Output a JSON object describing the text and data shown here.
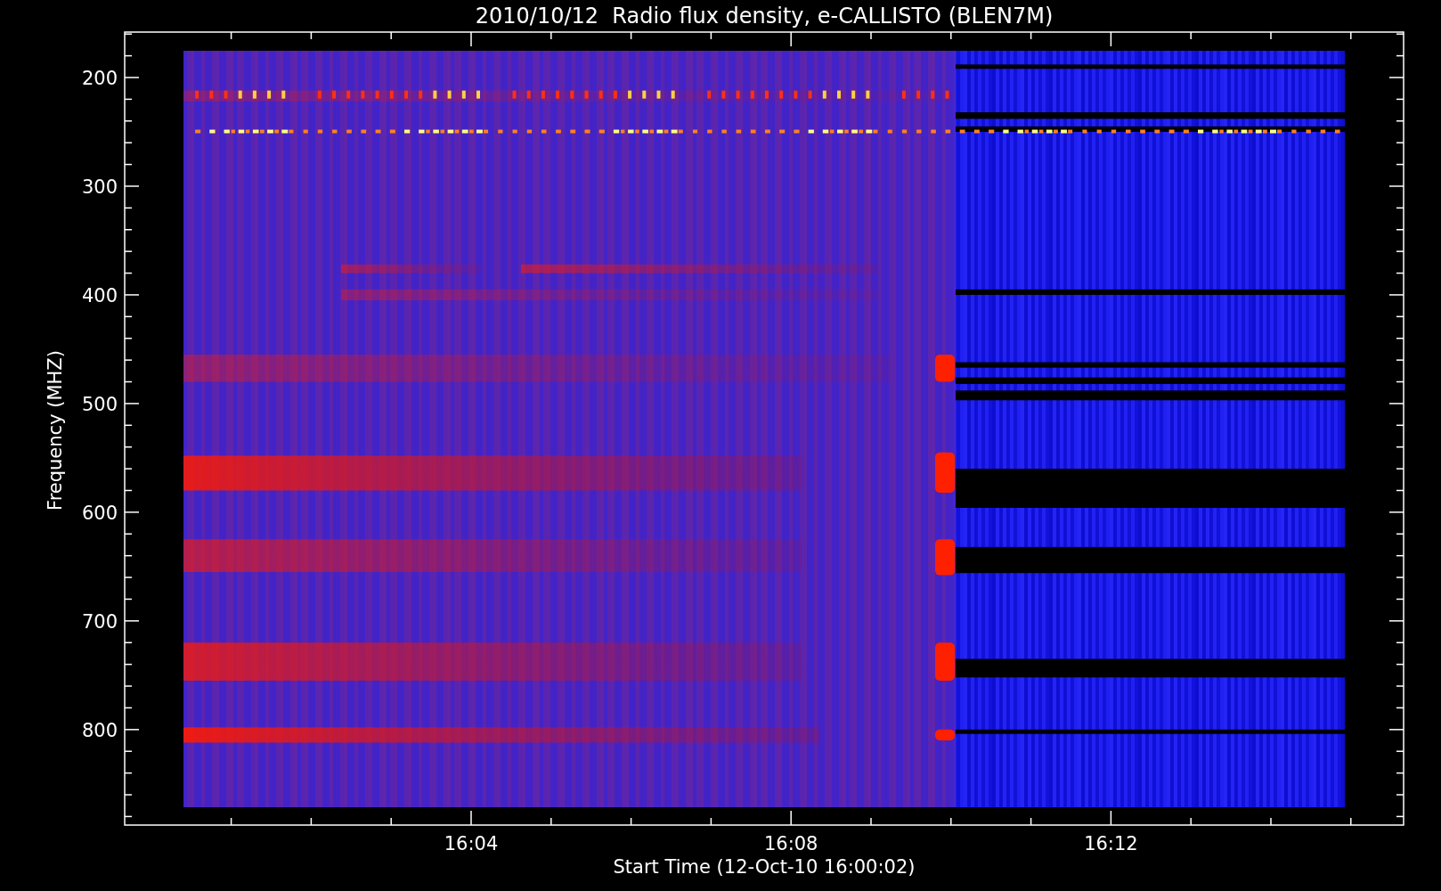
{
  "plot": {
    "title": "2010/10/12  Radio flux density, e-CALLISTO (BLEN7M)",
    "xlabel": "Start Time (12-Oct-10 16:00:02)",
    "ylabel": "Frequency (MHZ)",
    "y_tick_labels": [
      "200",
      "300",
      "400",
      "500",
      "600",
      "700",
      "800"
    ],
    "x_tick_labels": [
      "16:04",
      "16:08",
      "16:12"
    ]
  }
}
